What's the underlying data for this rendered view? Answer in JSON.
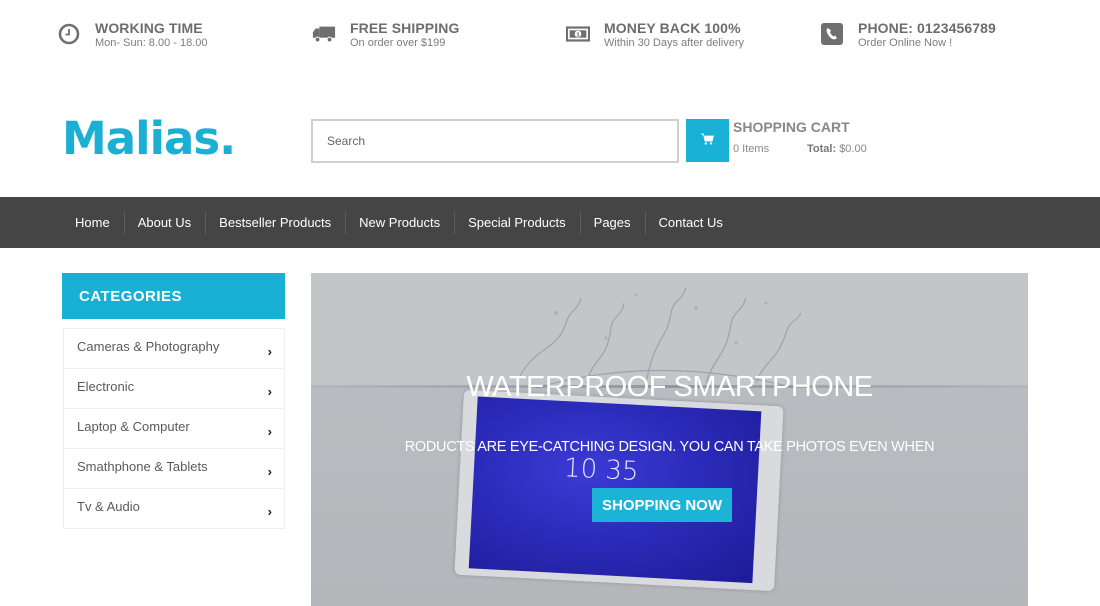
{
  "topbar": {
    "items": [
      {
        "icon": "clock-icon",
        "title": "WORKING TIME",
        "subtitle": "Mon- Sun: 8.00 - 18.00"
      },
      {
        "icon": "truck-icon",
        "title": "FREE SHIPPING",
        "subtitle": "On order over $199"
      },
      {
        "icon": "money-icon",
        "title": "MONEY BACK 100%",
        "subtitle": "Within 30 Days after delivery"
      },
      {
        "icon": "phone-icon",
        "title": "PHONE: 0123456789",
        "subtitle": "Order Online Now !"
      }
    ]
  },
  "header": {
    "logo": "Malias.",
    "search_placeholder": "Search",
    "cart": {
      "icon": "cart-icon",
      "title": "SHOPPING CART",
      "items": "0 Items",
      "total_label": "Total:",
      "total_value": "$0.00"
    }
  },
  "nav": {
    "items": [
      "Home",
      "About Us",
      "Bestseller Products",
      "New Products",
      "Special Products",
      "Pages",
      "Contact Us"
    ]
  },
  "sidebar": {
    "title": "CATEGORIES",
    "items": [
      {
        "label": "Cameras & Photography",
        "icon": "chevron-right-icon"
      },
      {
        "label": "Electronic",
        "icon": "chevron-right-icon"
      },
      {
        "label": "Laptop & Computer",
        "icon": "chevron-right-icon"
      },
      {
        "label": "Smathphone & Tablets",
        "icon": "chevron-right-icon"
      },
      {
        "label": "Tv & Audio",
        "icon": "chevron-right-icon"
      }
    ],
    "chevron_glyph": "›"
  },
  "banner": {
    "title": "WATERPROOF SMARTPHONE",
    "subtitle": "RODUCTS ARE EYE-CATCHING DESIGN. YOU CAN TAKE PHOTOS EVEN WHEN",
    "button_label": "SHOPPING NOW",
    "device_clock": "10 35"
  },
  "colors": {
    "accent": "#1aafd3",
    "nav_bg": "#454545",
    "text_gray": "#6d6d6d"
  }
}
